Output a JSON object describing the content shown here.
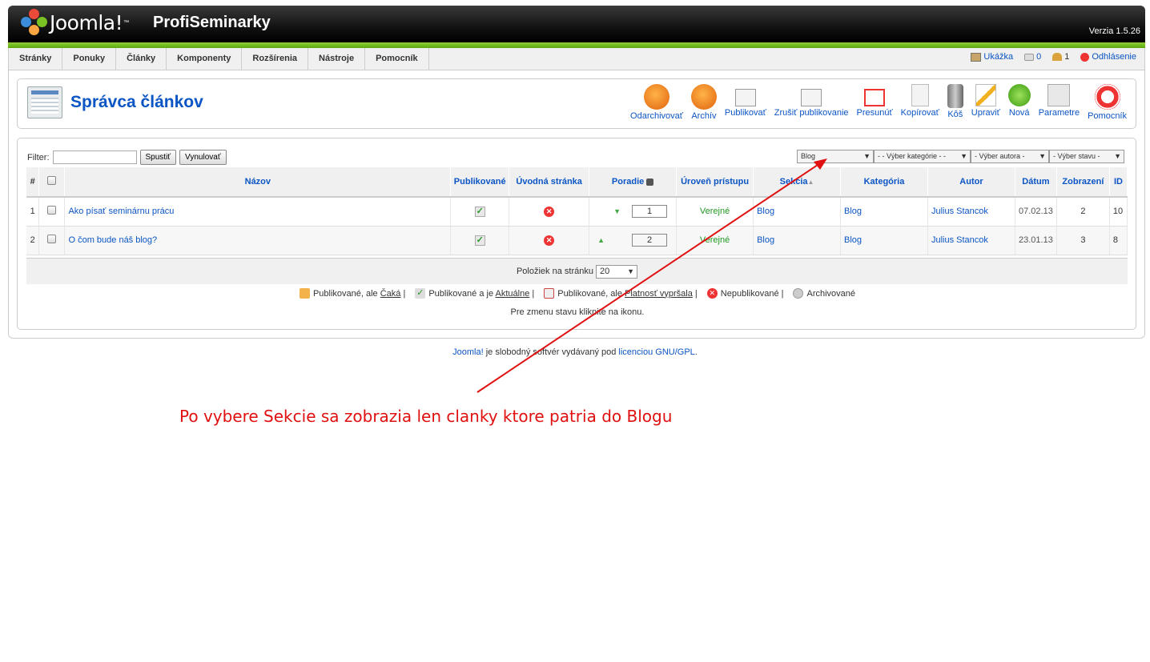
{
  "header": {
    "logo_text": "Joomla!",
    "logo_tm": "™",
    "site_title": "ProfiSeminarky",
    "version": "Verzia 1.5.26"
  },
  "menu": [
    "Stránky",
    "Ponuky",
    "Články",
    "Komponenty",
    "Rozšírenia",
    "Nástroje",
    "Pomocník"
  ],
  "status": {
    "preview": "Ukážka",
    "messages": "0",
    "users": "1",
    "logout": "Odhlásenie"
  },
  "page": {
    "title": "Správca článkov"
  },
  "toolbar": [
    {
      "label": "Odarchivovať",
      "icon": "unarchive-icon"
    },
    {
      "label": "Archív",
      "icon": "archive-icon"
    },
    {
      "label": "Publikovať",
      "icon": "publish-icon"
    },
    {
      "label": "Zrušiť publikovanie",
      "icon": "unpublish-icon"
    },
    {
      "label": "Presunúť",
      "icon": "move-icon"
    },
    {
      "label": "Kopírovať",
      "icon": "copy-icon"
    },
    {
      "label": "Kôš",
      "icon": "trash-icon"
    },
    {
      "label": "Upraviť",
      "icon": "edit-icon"
    },
    {
      "label": "Nová",
      "icon": "new-icon"
    },
    {
      "label": "Parametre",
      "icon": "params-icon"
    },
    {
      "label": "Pomocník",
      "icon": "help-icon"
    }
  ],
  "filter": {
    "label": "Filter:",
    "value": "",
    "go": "Spustiť",
    "reset": "Vynulovať"
  },
  "selects": {
    "section": "Blog",
    "category": "- - Výber kategórie - -",
    "author": "- Výber autora -",
    "state": "- Výber stavu -"
  },
  "table": {
    "headers": {
      "num": "#",
      "title": "Názov",
      "published": "Publikované",
      "front": "Úvodná stránka",
      "order": "Poradie",
      "access": "Úroveň prístupu",
      "section": "Sekcia",
      "category": "Kategória",
      "author": "Autor",
      "date": "Dátum",
      "hits": "Zobrazení",
      "id": "ID"
    },
    "rows": [
      {
        "num": "1",
        "title": "Ako písať seminárnu prácu",
        "order": "1",
        "access": "Verejné",
        "section": "Blog",
        "category": "Blog",
        "author": "Julius Stancok",
        "date": "07.02.13",
        "hits": "2",
        "id": "10"
      },
      {
        "num": "2",
        "title": "O čom bude náš blog?",
        "order": "2",
        "access": "Verejné",
        "section": "Blog",
        "category": "Blog",
        "author": "Julius Stancok",
        "date": "23.01.13",
        "hits": "3",
        "id": "8"
      }
    ]
  },
  "pager": {
    "label": "Položiek na stránku",
    "value": "20"
  },
  "legend": {
    "pending_a": "Publikované, ale ",
    "pending_b": "Čaká",
    "pending_c": " |",
    "current_a": "Publikované a je ",
    "current_b": "Aktuálne",
    "current_c": " |",
    "expired_a": "Publikované, ale ",
    "expired_b": "Platnosť vypršala",
    "expired_c": " |",
    "unpublished": "Nepublikované |",
    "archived": "Archivované"
  },
  "hint": "Pre zmenu stavu kliknite na ikonu.",
  "footer": {
    "joomla": "Joomla!",
    "mid": " je slobodný softvér vydávaný pod ",
    "license": "licenciou GNU/GPL",
    "end": "."
  },
  "annotation": "Po vybere Sekcie sa zobrazia len clanky ktore patria do Blogu",
  "colors": {
    "accent": "#0b55c4",
    "annotation": "#e01010",
    "green_bar": "#7ac124"
  }
}
